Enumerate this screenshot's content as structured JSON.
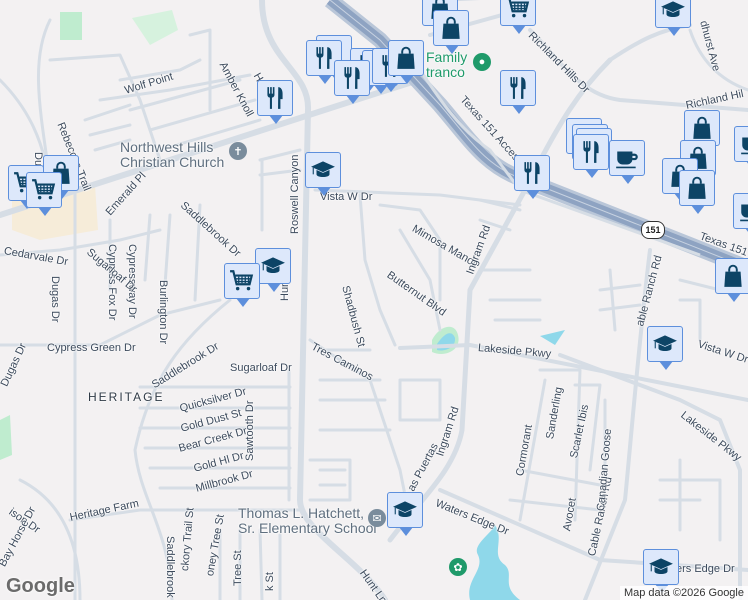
{
  "map": {
    "labels": {
      "wolf_point": "Wolf Point",
      "rebeccas_trail": "Rebeccas Trail",
      "amber_knoll": "Amber Knoll",
      "hunt_ln_top": "Hunt Ln",
      "hunt_ln": "Hunt Ln",
      "hunt_ln_bottom": "Hunt Ln",
      "emerald_pl": "Emerald Pl",
      "cypress_fox_dr": "Cypress Fox Dr",
      "cypressway_dr": "Cypressway Dr",
      "burlington_dr": "Burlington Dr",
      "saddlebrook_dr_top": "Saddlebrook Dr",
      "saddlebrook_dr_mid": "Saddlebrook Dr",
      "saddlebrook_bottom": "Saddlebrook",
      "roswell_canyon": "Roswell Canyon",
      "vista_w_dr": "Vista W Dr",
      "vista_w_dr_east": "Vista W Dr",
      "cedarvale_dr": "Cedarvale Dr",
      "sugarloaf_dr_west": "Sugarloaf Dr",
      "dugas_dr": "Dugas Dr",
      "dugas_dr_south": "Dugas Dr",
      "du": "Du",
      "cypress_green_dr": "Cypress Green Dr",
      "sugarloaf_dr": "Sugarloaf Dr",
      "quicksilver_dr": "Quicksilver Dr",
      "gold_dust_st": "Gold Dust St",
      "bear_creek_dr": "Bear Creek Dr",
      "gold_hl_dr": "Gold Hl Dr",
      "millbrook_dr": "Millbrook Dr",
      "sawtooth_dr": "Sawtooth Dr",
      "heritage_farm": "Heritage Farm",
      "davison_dr": "ison Dr",
      "bay_horse_dr": "Bay Horse Dr",
      "hickory_trail_st": "ckory Trail St",
      "honey_tree_st": "oney Tree St",
      "tree_st": "Tree St",
      "k_st": "k St",
      "tres_caminos": "Tres Caminos",
      "shadbush_st": "Shadbush St",
      "butternut_blvd": "Butternut Blvd",
      "mimosa_manor": "Mimosa Manor",
      "ingram_rd_north": "Ingram Rd",
      "ingram_rd_south": "Ingram Rd",
      "las_puertas": "Las Puertas",
      "richland_hills_dr": "Richland Hills Dr",
      "richland_hills_east": "Richland Hil",
      "ashhurst_ave": "dhurst Ave",
      "texas_151_access": "Texas 151 Access",
      "texas_151": "Texas 151",
      "lakeside_pkwy": "Lakeside Pkwy",
      "lakeside_pkwy_east": "Lakeside Pkwy",
      "cable_ranch_rd_north": "able Ranch Rd",
      "cable_ranch_rd": "Cable Ranch Rd",
      "cormorant": "Cormorant",
      "sanderling": "Sanderling",
      "scarlet_ibis": "Scarlet Ibis",
      "canadian_goose": "Canadian Goose",
      "avocet": "Avocet",
      "waters_edge_dr": "Waters Edge Dr",
      "waters_edge_dr_east": "ers Edge Dr",
      "heritage": "HERITAGE"
    },
    "pois": {
      "church": "Northwest Hills Christian Church",
      "church_line1": "Northwest Hills",
      "church_line2": "Christian Church",
      "family": "Family",
      "family_line2": "tranco",
      "school_line1": "Thomas L. Hatchett,",
      "school_line2": "Sr. Elementary School"
    },
    "highway_shield": "151",
    "google_logo": "Google",
    "attribution": "Map data ©2026 Google",
    "colors": {
      "background": "#f3f1f2",
      "road": "#d6dde5",
      "highway": "#8ea3c2",
      "water": "#8fd8ea",
      "park": "#bfeccf",
      "marker_fill": "#dde8fb",
      "marker_border": "#5d8fdc",
      "marker_icon": "#0d4466"
    },
    "marker_types": [
      "restaurant",
      "shopping",
      "grocery",
      "school",
      "cafe"
    ]
  }
}
